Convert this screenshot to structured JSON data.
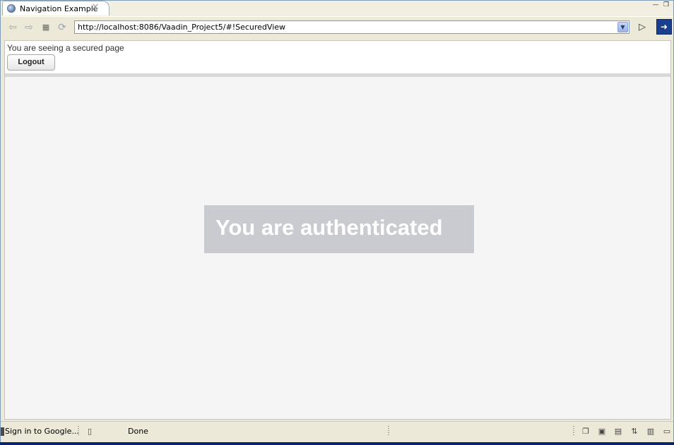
{
  "window": {
    "tab_title": "Navigation Example",
    "tab_close_glyph": "✕",
    "minimize_glyph": "—",
    "restore_glyph": "❐"
  },
  "toolbar": {
    "url": "http://localhost:8086/Vaadin_Project5/#!SecuredView",
    "icons": [
      "back-icon",
      "forward-icon",
      "stop-icon",
      "refresh-icon",
      "go-icon",
      "external-browser-icon"
    ]
  },
  "page": {
    "secure_message": "You are seeing a secured page",
    "logout_label": "Logout",
    "auth_message": "You are authenticated"
  },
  "statusbar": {
    "google_text": "Sign in to Google...",
    "status_text": "Done"
  },
  "colors": {
    "auth_panel_bg": "#c9cbd0",
    "page_bg": "#f5f5f5",
    "chrome_bg": "#ece9d8"
  }
}
